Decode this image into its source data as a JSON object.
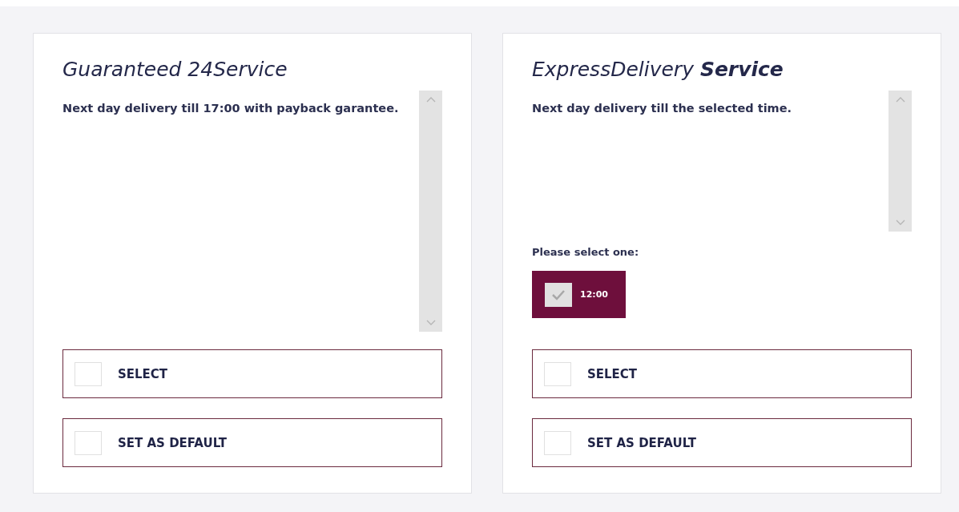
{
  "services": [
    {
      "title": "Guaranteed 24Service",
      "description": "Next day delivery till 17:00 with payback garantee.",
      "options": [
        {
          "label": "SELECT",
          "checked": false
        },
        {
          "label": "SET AS DEFAULT",
          "checked": false
        }
      ]
    },
    {
      "title": "ExpressDelivery **Service**",
      "description": "Next day delivery till the selected time.",
      "prompt": "Please select one:",
      "time_options": [
        {
          "label": "12:00",
          "checked": true
        }
      ],
      "options": [
        {
          "label": "SELECT",
          "checked": false
        },
        {
          "label": "SET AS DEFAULT",
          "checked": false
        }
      ]
    }
  ]
}
